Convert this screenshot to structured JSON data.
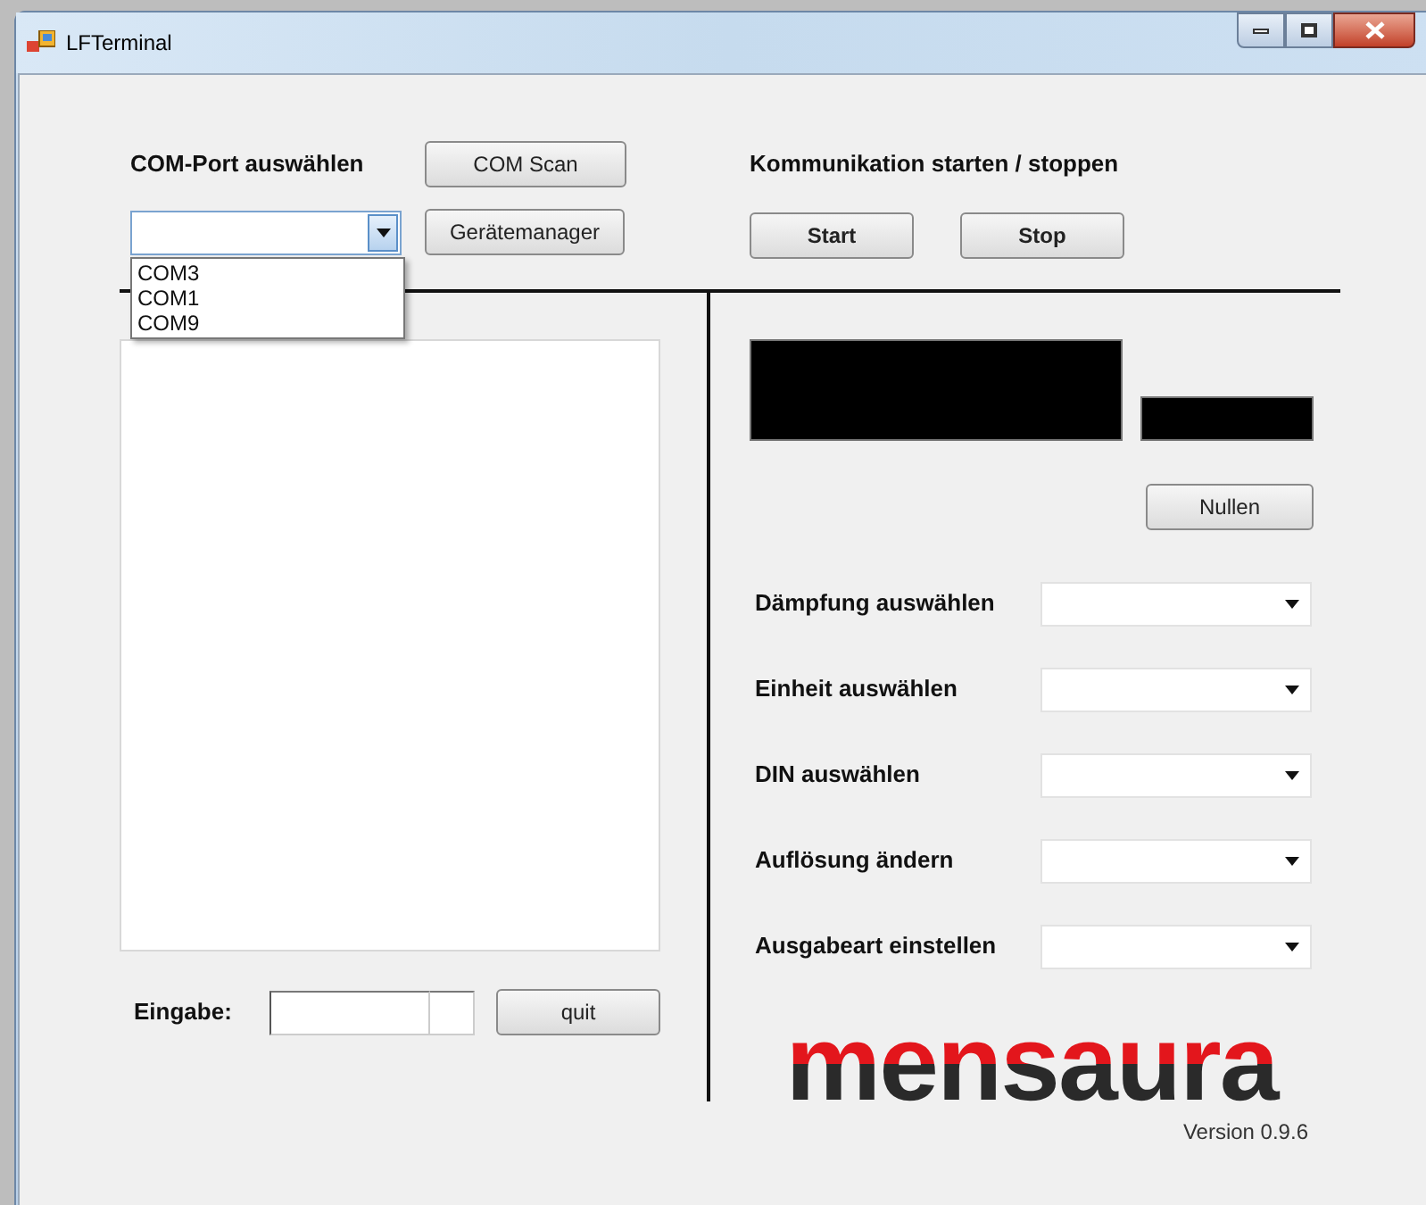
{
  "window": {
    "title": "LFTerminal"
  },
  "com_port": {
    "label": "COM-Port auswählen",
    "scan_button": "COM Scan",
    "device_manager_button": "Gerätemanager",
    "dropdown": {
      "expanded": true,
      "options": [
        {
          "label": "COM3",
          "selected": false
        },
        {
          "label": "COM1",
          "selected": false
        },
        {
          "label": "COM9",
          "selected": false
        }
      ]
    }
  },
  "communication": {
    "label": "Kommunikation starten / stoppen",
    "buttons": [
      "Start",
      "Stop"
    ]
  },
  "zero_button": "Nullen",
  "settings": [
    {
      "label": "Dämpfung auswählen"
    },
    {
      "label": "Einheit auswählen"
    },
    {
      "label": "DIN auswählen"
    },
    {
      "label": "Auflösung ändern"
    },
    {
      "label": "Ausgabeart einstellen"
    }
  ],
  "input": {
    "label": "Eingabe:"
  },
  "quit_button": "quit",
  "logo": "mensaura",
  "version": "Version 0.9.6"
}
